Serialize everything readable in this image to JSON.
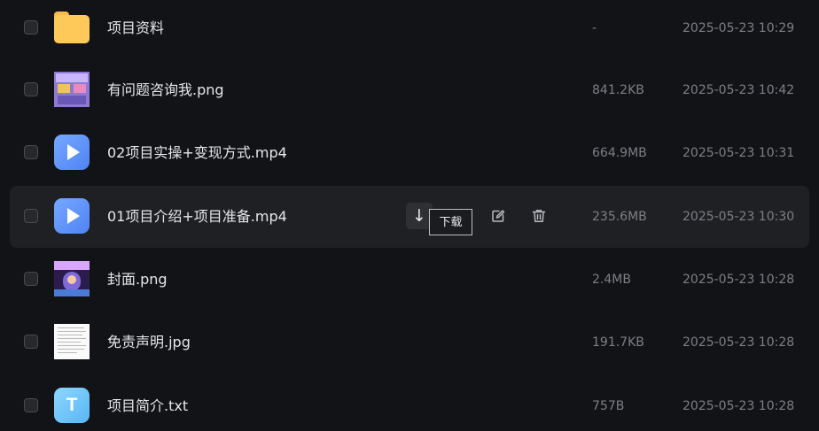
{
  "files": [
    {
      "name": "项目资料",
      "size": "-",
      "date": "2025-05-23 10:29",
      "icon": "folder-icon"
    },
    {
      "name": "有问题咨询我.png",
      "size": "841.2KB",
      "date": "2025-05-23 10:42",
      "icon": "image-thumbnail"
    },
    {
      "name": "02项目实操+变现方式.mp4",
      "size": "664.9MB",
      "date": "2025-05-23 10:31",
      "icon": "video-icon"
    },
    {
      "name": "01项目介绍+项目准备.mp4",
      "size": "235.6MB",
      "date": "2025-05-23 10:30",
      "icon": "video-icon"
    },
    {
      "name": "封面.png",
      "size": "2.4MB",
      "date": "2025-05-23 10:28",
      "icon": "image-thumbnail"
    },
    {
      "name": "免责声明.jpg",
      "size": "191.7KB",
      "date": "2025-05-23 10:28",
      "icon": "image-thumbnail"
    },
    {
      "name": "项目简介.txt",
      "size": "757B",
      "date": "2025-05-23 10:28",
      "icon": "text-file-icon"
    }
  ],
  "hovered_row_actions": {
    "download_glyph": "↓",
    "tooltip": "下载"
  },
  "text_icon_letter": "T",
  "colors": {
    "background": "#121316",
    "hover_row": "#1f2023",
    "folder": "#ffc95a",
    "video_icon": "#5b8ff9",
    "text_icon": "#6cc2fa"
  }
}
